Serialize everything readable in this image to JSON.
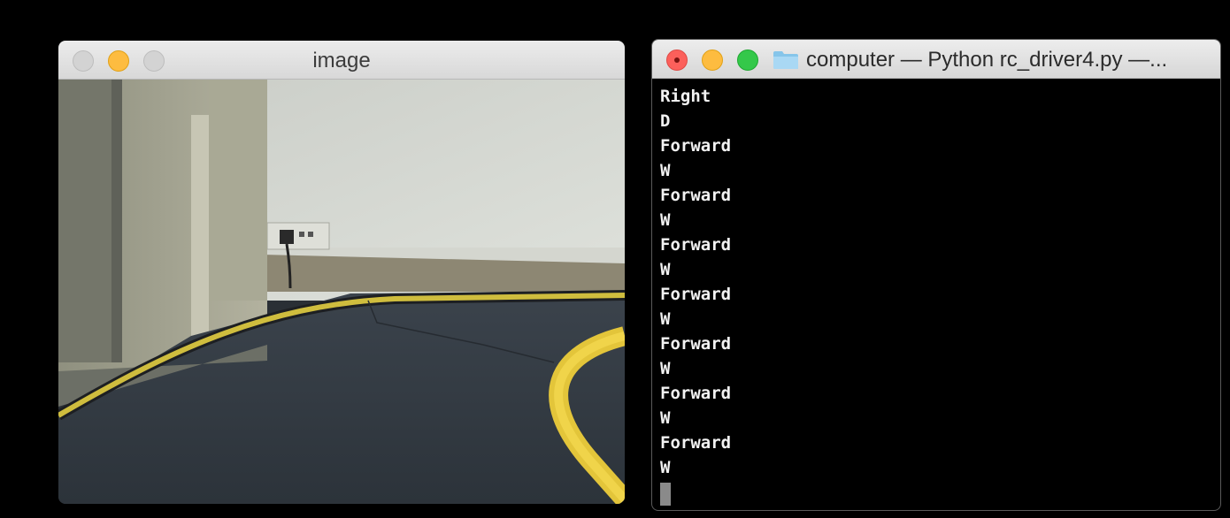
{
  "image_window": {
    "title": "image",
    "buttons": {
      "close_color": "#d3d3d3",
      "minimize_color": "#fdbc40",
      "zoom_color": "#d3d3d3"
    }
  },
  "terminal_window": {
    "title": "computer — Python rc_driver4.py —...",
    "icon": "folder-icon",
    "buttons": {
      "close_color": "#fc605b",
      "minimize_color": "#fdbc40",
      "zoom_color": "#34c84a"
    },
    "lines": [
      "Right",
      "D",
      "Forward",
      "W",
      "Forward",
      "W",
      "Forward",
      "W",
      "Forward",
      "W",
      "Forward",
      "W",
      "Forward",
      "W",
      "Forward",
      "W"
    ]
  }
}
